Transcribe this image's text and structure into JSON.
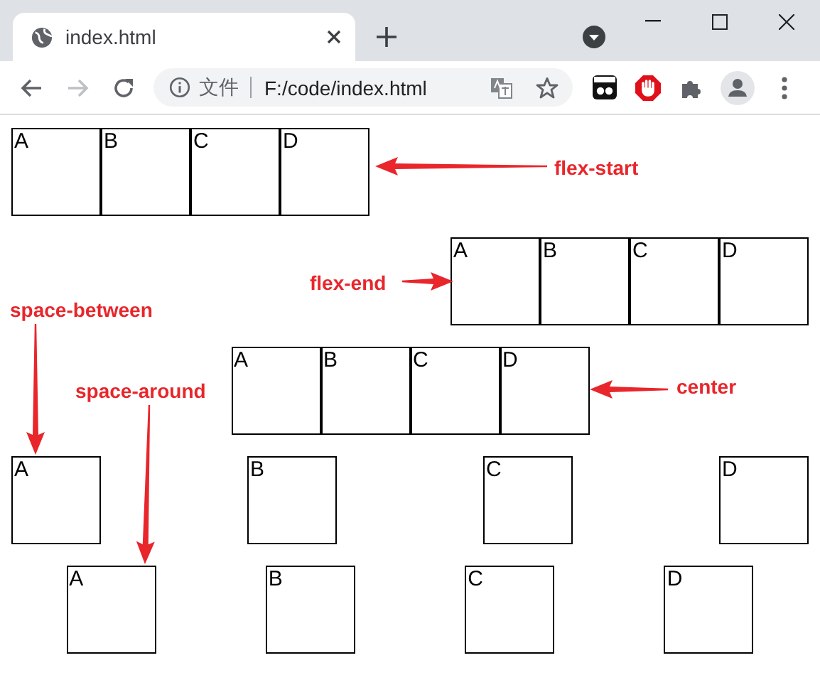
{
  "window": {
    "tab": {
      "title": "index.html"
    },
    "address_bar": {
      "security_label": "文件",
      "url": "F:/code/index.html"
    }
  },
  "rows": [
    {
      "kind": "start",
      "label": "flex-start",
      "items": [
        "A",
        "B",
        "C",
        "D"
      ]
    },
    {
      "kind": "end",
      "label": "flex-end",
      "items": [
        "A",
        "B",
        "C",
        "D"
      ]
    },
    {
      "kind": "middle",
      "label": "center",
      "items": [
        "A",
        "B",
        "C",
        "D"
      ]
    },
    {
      "kind": "between",
      "label": "space-between",
      "items": [
        "A",
        "B",
        "C",
        "D"
      ]
    },
    {
      "kind": "around",
      "label": "space-around",
      "items": [
        "A",
        "B",
        "C",
        "D"
      ]
    }
  ]
}
